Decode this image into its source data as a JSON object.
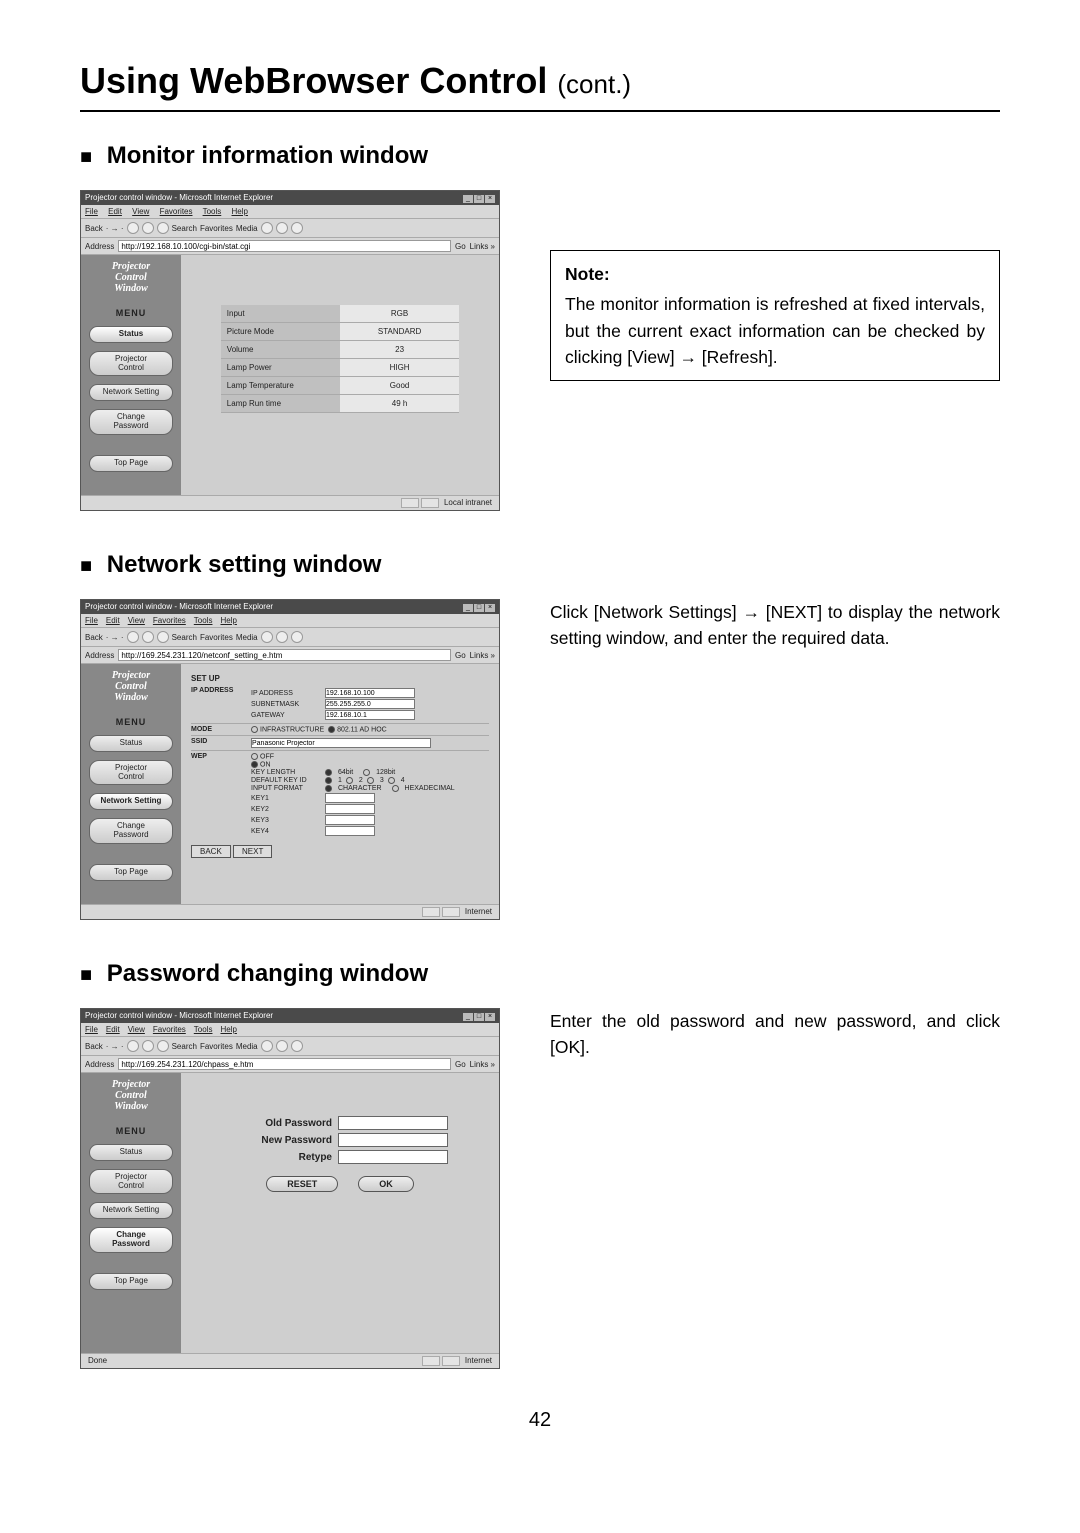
{
  "page_title": "Using WebBrowser Control",
  "page_title_suffix": "(cont.)",
  "page_number": "42",
  "section_monitor": {
    "heading": "Monitor information window",
    "note_label": "Note:",
    "note_text": "The monitor information is refreshed at fixed intervals, but the current exact information can be checked by clicking [View] → [Refresh]."
  },
  "section_network": {
    "heading": "Network setting window",
    "body": "Click [Network Settings] → [NEXT] to display the network setting window, and enter the required data."
  },
  "section_password": {
    "heading": "Password changing window",
    "body": "Enter the old password and new password, and click [OK]."
  },
  "common": {
    "titlebar": "Projector control window - Microsoft Internet Explorer",
    "menus": {
      "file": "File",
      "edit": "Edit",
      "view": "View",
      "favorites": "Favorites",
      "tools": "Tools",
      "help": "Help"
    },
    "toolbar": {
      "back": "Back",
      "search": "Search",
      "favorites": "Favorites",
      "media": "Media"
    },
    "address_label": "Address",
    "go": "Go",
    "links": "Links »",
    "pcw_line1": "Projector",
    "pcw_line2": "Control",
    "pcw_line3": "Window",
    "menu_label": "MENU",
    "side": {
      "status": "Status",
      "projector_control": "Projector\nControl",
      "network_setting": "Network Setting",
      "change_password": "Change\nPassword",
      "top_page": "Top Page"
    },
    "status_internet": "Internet",
    "status_local": "Local intranet"
  },
  "shot_monitor": {
    "address": "http://192.168.10.100/cgi-bin/stat.cgi",
    "rows": {
      "input_k": "Input",
      "input_v": "RGB",
      "picture_k": "Picture Mode",
      "picture_v": "STANDARD",
      "volume_k": "Volume",
      "volume_v": "23",
      "lamp_power_k": "Lamp Power",
      "lamp_power_v": "HIGH",
      "lamp_temp_k": "Lamp Temperature",
      "lamp_temp_v": "Good",
      "lamp_run_k": "Lamp Run time",
      "lamp_run_v": "49 h"
    }
  },
  "shot_network": {
    "address": "http://169.254.231.120/netconf_setting_e.htm",
    "setup_title": "SET UP",
    "ip_label": "IP ADDRESS",
    "ip_addr_k": "IP ADDRESS",
    "ip_addr_v": "192.168.10.100",
    "subnet_k": "SUBNETMASK",
    "subnet_v": "255.255.255.0",
    "gateway_k": "GATEWAY",
    "gateway_v": "192.168.10.1",
    "mode_label": "MODE",
    "mode_infra": "INFRASTRUCTURE",
    "mode_adhoc": "802.11 AD HOC",
    "ssid_label": "SSID",
    "ssid_v": "Panasonic Projector",
    "wep_label": "WEP",
    "wep_off": "OFF",
    "wep_on": "ON",
    "keylen_k": "KEY LENGTH",
    "keylen_64": "64bit",
    "keylen_128": "128bit",
    "defkey_k": "DEFAULT KEY ID",
    "d1": "1",
    "d2": "2",
    "d3": "3",
    "d4": "4",
    "infmt_k": "INPUT FORMAT",
    "infmt_char": "CHARACTER",
    "infmt_hex": "HEXADECIMAL",
    "key1": "KEY1",
    "key2": "KEY2",
    "key3": "KEY3",
    "key4": "KEY4",
    "btn_back": "BACK",
    "btn_next": "NEXT"
  },
  "shot_password": {
    "address": "http://169.254.231.120/chpass_e.htm",
    "old": "Old Password",
    "new": "New Password",
    "retype": "Retype",
    "reset": "RESET",
    "ok": "OK",
    "done": "Done"
  }
}
